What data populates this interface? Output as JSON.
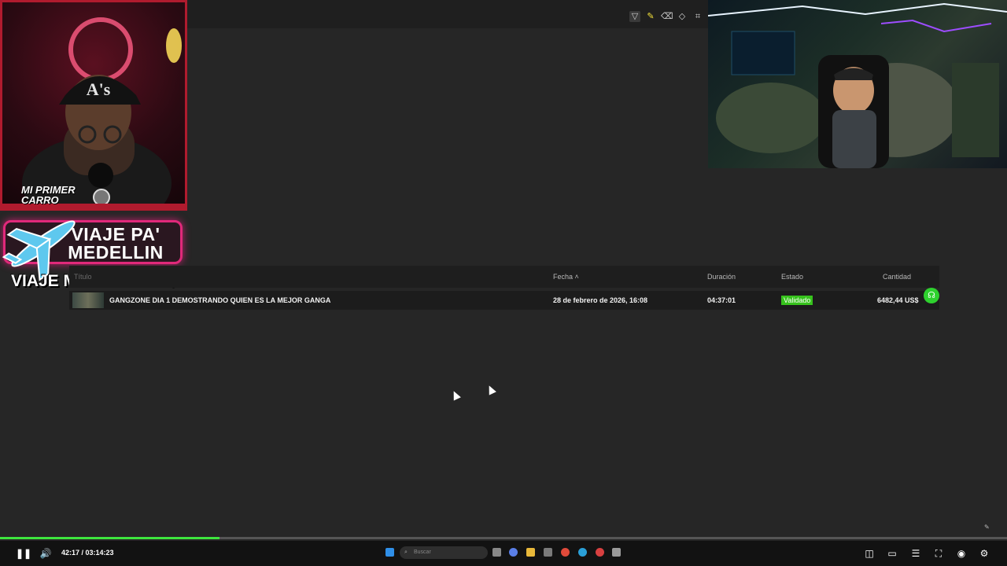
{
  "toolbar": {
    "tools": [
      "filter-icon",
      "highlighter-icon",
      "eraser-icon",
      "shapes-icon",
      "crop-icon",
      "expand-icon",
      "undo-icon",
      "redo-icon"
    ]
  },
  "overlay": {
    "tag_text": "MI PRIMER CARRO",
    "badge_text": "VIAJE PA' MEDELLIN",
    "counter_text": "VIAJE MEDELLIN 16/500"
  },
  "table": {
    "headers": {
      "titulo": "Título",
      "fecha": "Fecha",
      "duracion": "Duración",
      "estado": "Estado",
      "cantidad": "Cantidad"
    },
    "rows": [
      {
        "titulo": "GANGZONE DIA 1 DEMOSTRANDO QUIEN ES LA MEJOR GANGA",
        "fecha": "28 de febrero de 2026, 16:08",
        "duracion": "04:37:01",
        "estado": "Validado",
        "cantidad": "6482,44 US$"
      }
    ]
  },
  "colors": {
    "accent_green": "#36c21c",
    "progress_green": "#3ee53e",
    "badge_pink": "#e0297a"
  },
  "player": {
    "time": "42:17 / 03:14:23",
    "progress_fraction": 0.218,
    "search_placeholder": "Buscar"
  }
}
